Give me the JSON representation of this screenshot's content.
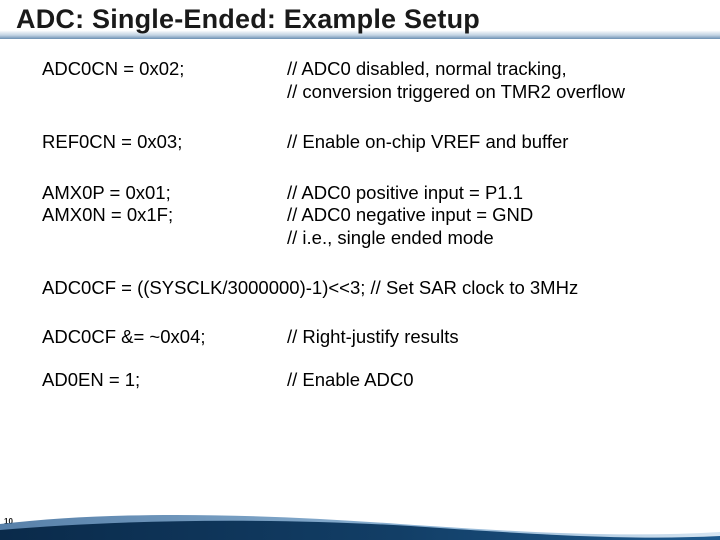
{
  "title": "ADC: Single-Ended: Example Setup",
  "rows": [
    {
      "code": "ADC0CN = 0x02;",
      "comment": "// ADC0 disabled, normal tracking,\n// conversion triggered on TMR2 overflow"
    },
    {
      "code": "REF0CN = 0x03;",
      "comment": "// Enable on-chip VREF and buffer"
    },
    {
      "code": "AMX0P = 0x01;\nAMX0N = 0x1F;",
      "comment": "// ADC0 positive input = P1.1\n// ADC0 negative input = GND\n// i.e., single ended mode"
    }
  ],
  "fullLine": "ADC0CF = ((SYSCLK/3000000)-1)<<3;   // Set SAR clock to 3MHz",
  "rows2": [
    {
      "code": "ADC0CF &= ~0x04;",
      "comment": "// Right-justify results"
    },
    {
      "code": "AD0EN = 1;",
      "comment": "// Enable ADC0"
    }
  ],
  "pageNumber": "10"
}
